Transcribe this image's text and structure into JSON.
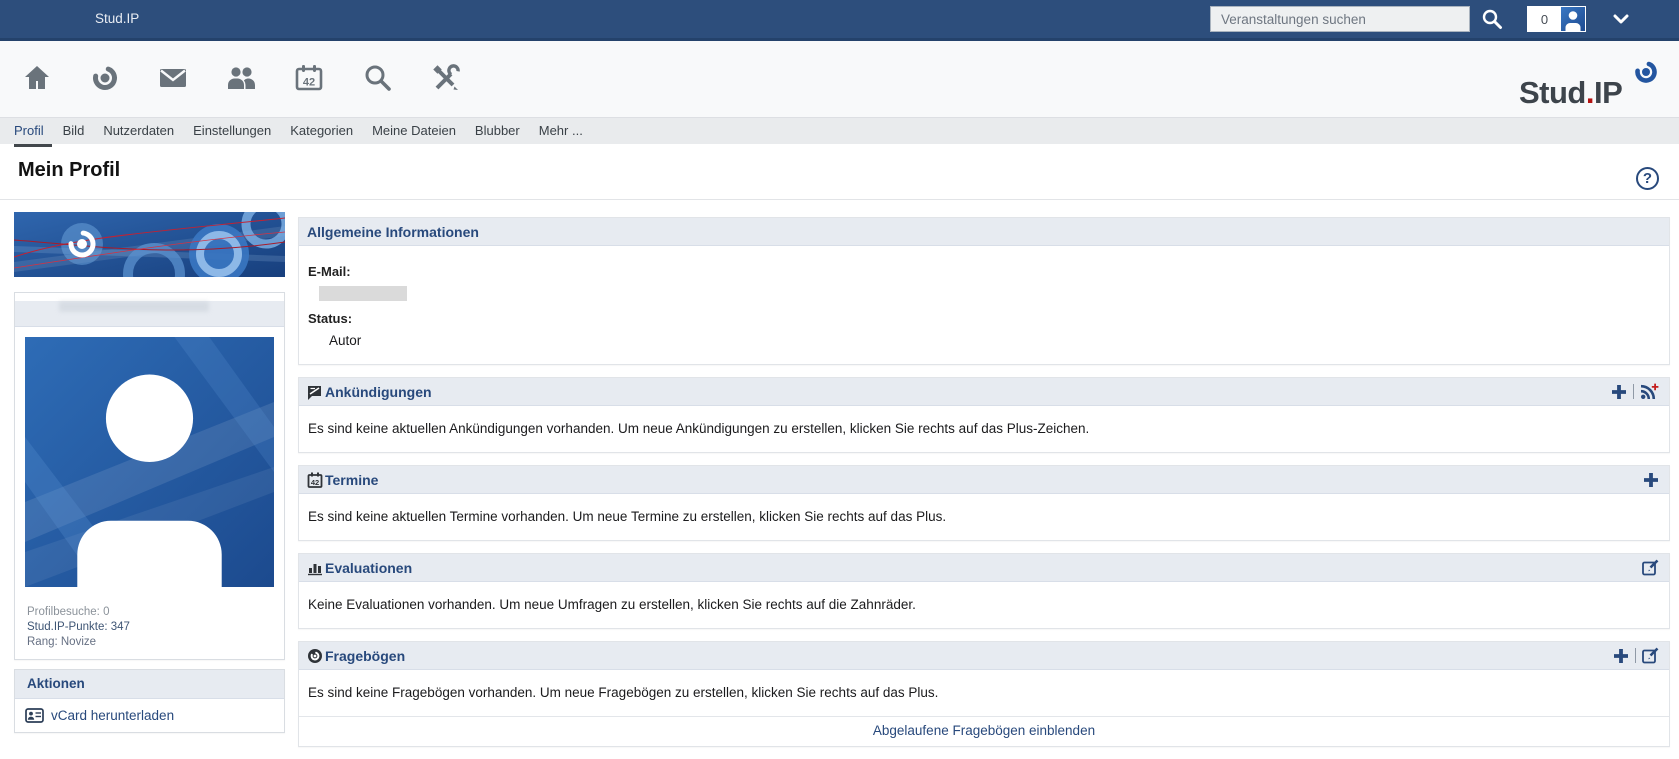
{
  "colors": {
    "brand_blue": "#28497c",
    "topbar_blue": "#2d4e7c",
    "header_strip": "#e7ebf1",
    "active_tab_underline": "#42474c",
    "logo_red": "#b41212",
    "rss_plus_red": "#c41e1e"
  },
  "topbar": {
    "title": "Stud.IP",
    "search_placeholder": "Veranstaltungen suchen",
    "notification_count": "0"
  },
  "iconbar": {
    "planner_label": "42",
    "logo": {
      "part1": "Stud",
      "dot": ".",
      "part2": "IP"
    }
  },
  "tabs": [
    {
      "label": "Profil",
      "active": true
    },
    {
      "label": "Bild"
    },
    {
      "label": "Nutzerdaten"
    },
    {
      "label": "Einstellungen"
    },
    {
      "label": "Kategorien"
    },
    {
      "label": "Meine Dateien"
    },
    {
      "label": "Blubber"
    },
    {
      "label": "Mehr ..."
    }
  ],
  "page": {
    "title": "Mein Profil",
    "help_glyph": "?"
  },
  "sidebar": {
    "stats": {
      "visits": "Profilbesuche: 0",
      "points": "Stud.IP-Punkte: 347",
      "rank": "Rang: Novize"
    },
    "actions": {
      "title": "Aktionen",
      "vcard_label": "vCard herunterladen"
    }
  },
  "sections": {
    "general": {
      "title": "Allgemeine Informationen",
      "email_label": "E-Mail:",
      "status_label": "Status:",
      "status_value": "Autor"
    },
    "announcements": {
      "title": "Ankündigungen",
      "empty_text": "Es sind keine aktuellen Ankündigungen vorhanden. Um neue Ankündigungen zu erstellen, klicken Sie rechts auf das Plus-Zeichen."
    },
    "dates": {
      "title": "Termine",
      "icon_label": "42",
      "empty_text": "Es sind keine aktuellen Termine vorhanden. Um neue Termine zu erstellen, klicken Sie rechts auf das Plus."
    },
    "evaluations": {
      "title": "Evaluationen",
      "empty_text": "Keine Evaluationen vorhanden. Um neue Umfragen zu erstellen, klicken Sie rechts auf die Zahnräder."
    },
    "questionnaires": {
      "title": "Fragebögen",
      "empty_text": "Es sind keine Fragebögen vorhanden. Um neue Fragebögen zu erstellen, klicken Sie rechts auf das Plus.",
      "footer_link": "Abgelaufene Fragebögen einblenden"
    }
  }
}
